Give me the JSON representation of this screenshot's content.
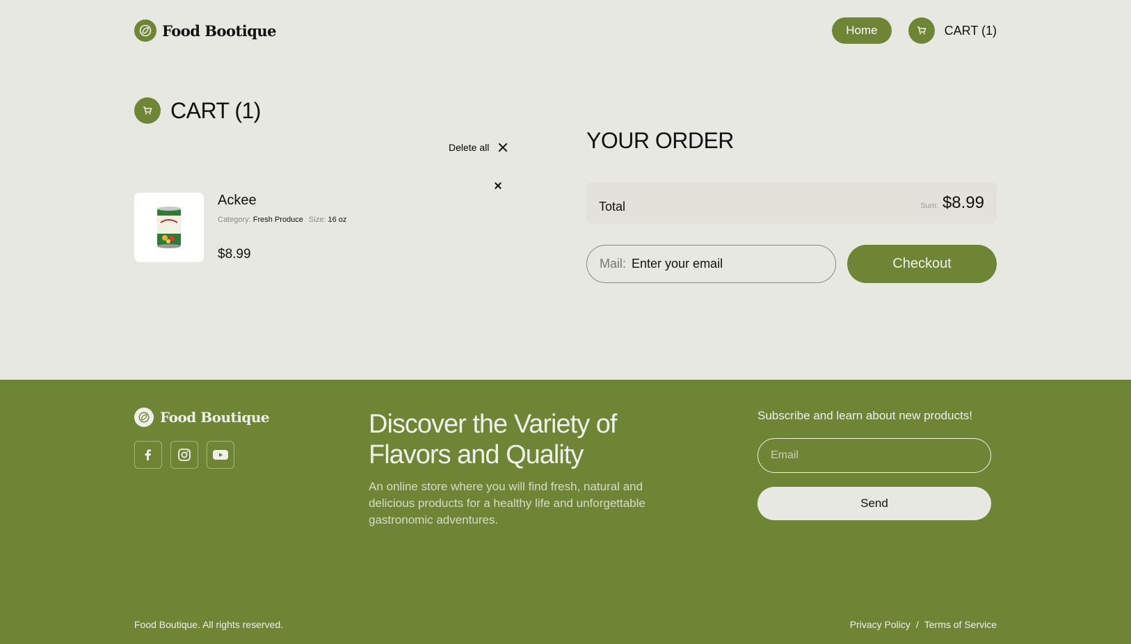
{
  "brand": {
    "name": "Food Bootique",
    "footer_name": "Food Boutique"
  },
  "nav": {
    "home_label": "Home",
    "cart_label": "CART (1)"
  },
  "cart": {
    "title": "CART (1)",
    "delete_all_label": "Delete all",
    "items": [
      {
        "name": "Ackee",
        "category_label": "Category:",
        "category": "Fresh Produce",
        "size_label": "Size:",
        "size": "16 oz",
        "price": "$8.99"
      }
    ]
  },
  "order": {
    "title": "YOUR ORDER",
    "total_label": "Total",
    "sum_label": "Sum:",
    "sum_value": "$8.99",
    "mail_label": "Mail:",
    "mail_placeholder": "Enter your email",
    "checkout_label": "Checkout"
  },
  "footer": {
    "heading": "Discover the Variety of Flavors and Quality",
    "description": "An online store where you will find fresh, natural and delicious products for a healthy life and unforgettable gastronomic adventures.",
    "subscribe_title": "Subscribe and learn about new products!",
    "email_placeholder": "Email",
    "send_label": "Send",
    "copyright": "Food Boutique. All rights reserved.",
    "privacy_label": "Privacy Policy",
    "separator": "/",
    "terms_label": "Terms of Service",
    "socials": [
      "facebook-icon",
      "instagram-icon",
      "youtube-icon"
    ]
  },
  "colors": {
    "accent": "#6e8535",
    "background": "#e8e8e3",
    "panel": "#e2e2da"
  }
}
